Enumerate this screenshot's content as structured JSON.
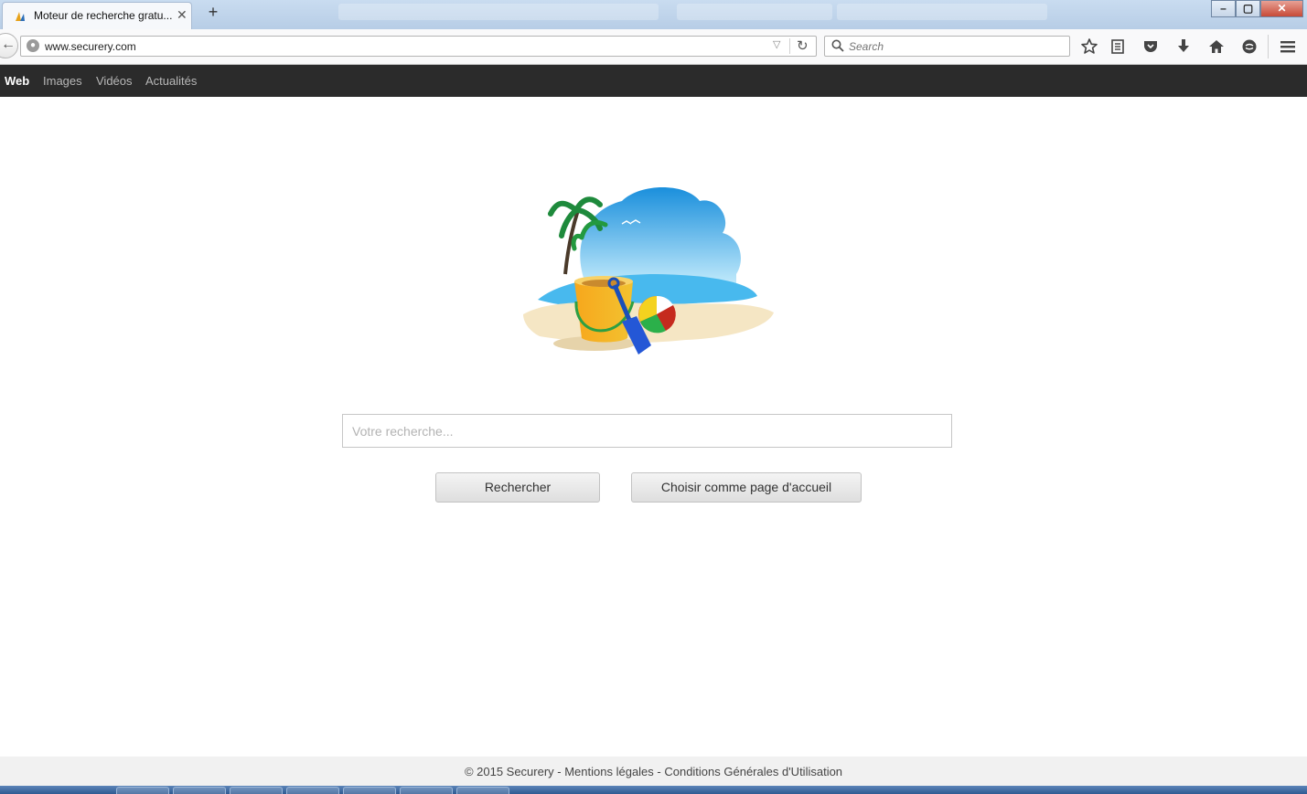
{
  "browser": {
    "tab": {
      "title": "Moteur de recherche gratu...",
      "close": "✕"
    },
    "new_tab": "+",
    "url": "www.securery.com",
    "search_placeholder": "Search",
    "window_controls": {
      "minimize": "–",
      "maximize": "▢",
      "close": "✕"
    },
    "toolbar_icons": [
      "star-icon",
      "reading-list-icon",
      "pocket-icon",
      "download-icon",
      "home-icon",
      "chat-icon",
      "menu-icon"
    ]
  },
  "site_nav": {
    "items": [
      {
        "label": "Web",
        "active": true
      },
      {
        "label": "Images",
        "active": false
      },
      {
        "label": "Vidéos",
        "active": false
      },
      {
        "label": "Actualités",
        "active": false
      }
    ]
  },
  "main": {
    "search_placeholder": "Votre recherche...",
    "search_button": "Rechercher",
    "homepage_button": "Choisir comme page d'accueil"
  },
  "footer": {
    "text": "© 2015 Securery - Mentions légales - Conditions Générales d'Utilisation"
  },
  "colors": {
    "nav_bg": "#2b2b2b",
    "sky": "#3aa9e8",
    "sea": "#5fc6ef",
    "sand": "#f5e6c4"
  }
}
